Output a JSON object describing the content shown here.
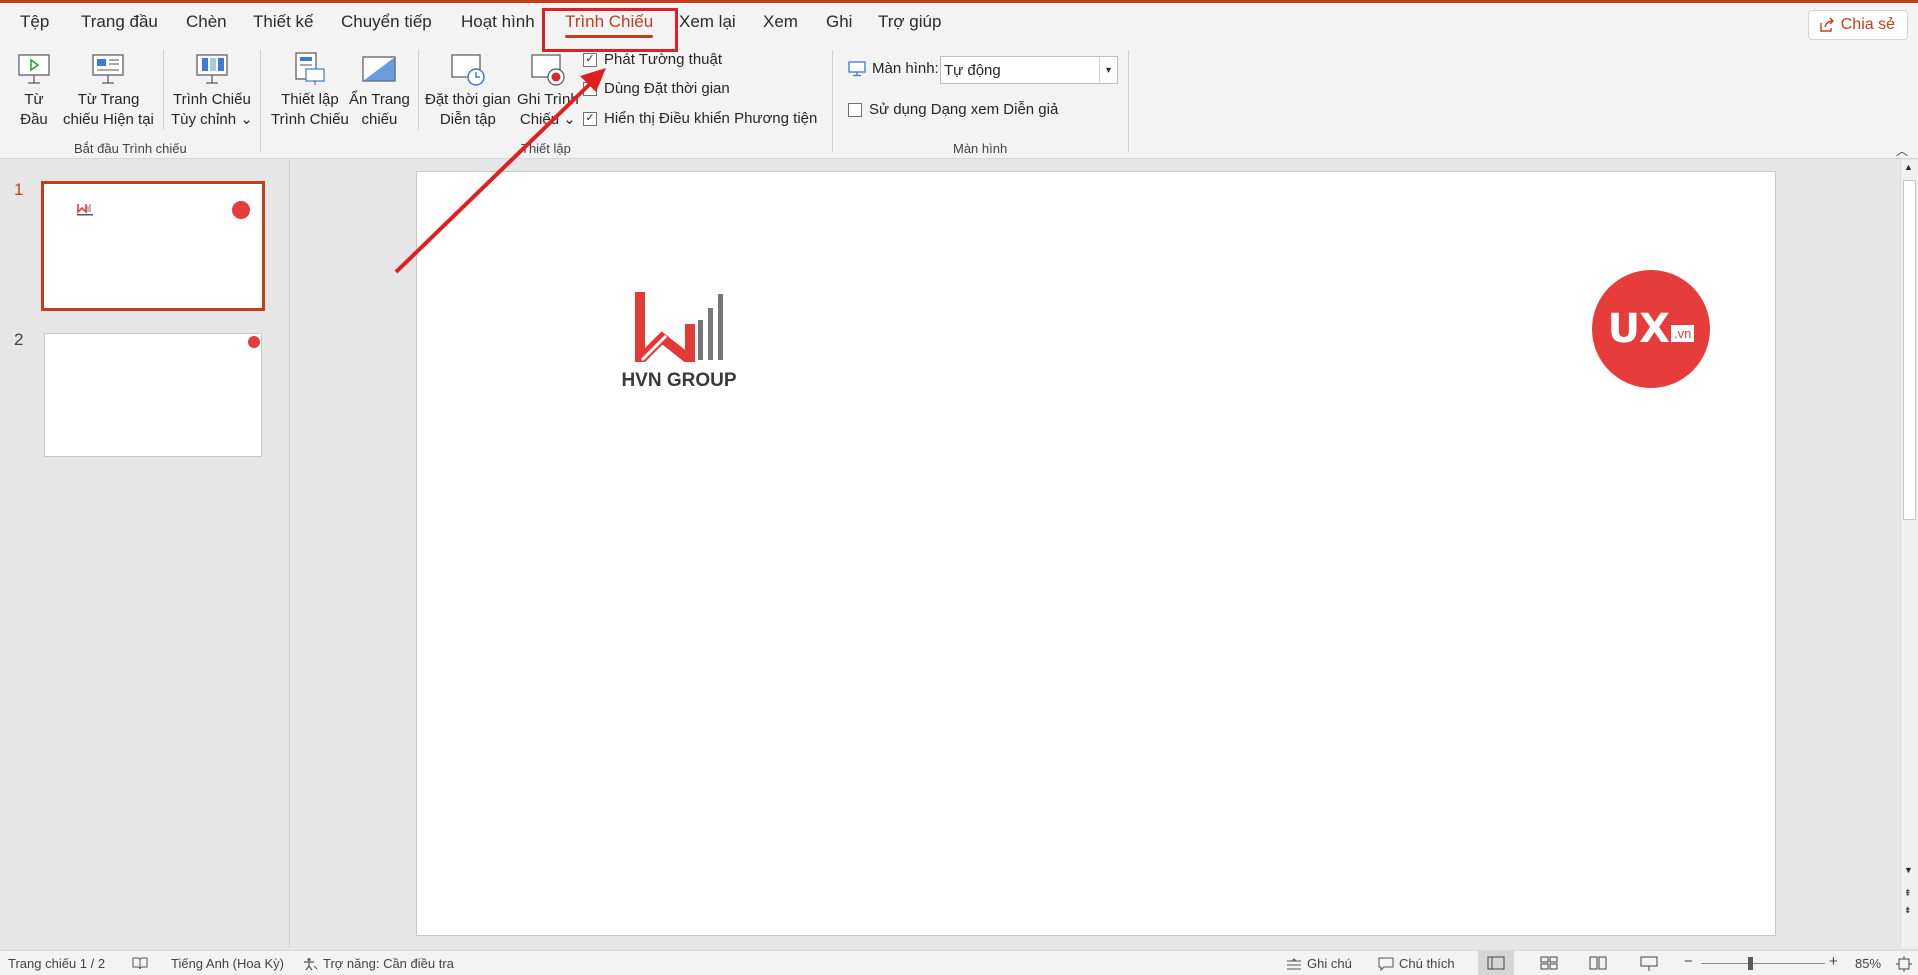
{
  "tabs": [
    {
      "label": "Tệp"
    },
    {
      "label": "Trang đầu"
    },
    {
      "label": "Chèn"
    },
    {
      "label": "Thiết kế"
    },
    {
      "label": "Chuyển tiếp"
    },
    {
      "label": "Hoạt hình"
    },
    {
      "label": "Trình Chiếu"
    },
    {
      "label": "Xem lại"
    },
    {
      "label": "Xem"
    },
    {
      "label": "Ghi"
    },
    {
      "label": "Trợ giúp"
    }
  ],
  "active_tab": "Trình Chiếu",
  "share_label": "Chia sẻ",
  "ribbon": {
    "start_group": {
      "label": "Bắt đầu Trình chiếu",
      "from_beginning": [
        "Từ",
        "Đầu"
      ],
      "from_current": [
        "Từ Trang",
        "chiếu Hiện tại"
      ],
      "custom": [
        "Trình Chiếu",
        "Tùy chỉnh ⌄"
      ]
    },
    "setup_group": {
      "label": "Thiết lập",
      "setup_show": [
        "Thiết lập",
        "Trình Chiếu"
      ],
      "hide_slide": [
        "Ẩn Trang",
        "chiếu"
      ],
      "rehearse": [
        "Đặt thời gian",
        "Diễn tập"
      ],
      "record": [
        "Ghi Trình",
        "Chiếu ⌄"
      ],
      "play_narrations": "Phát Tường thuật",
      "use_timings": "Dùng Đặt thời gian",
      "show_media_controls": "Hiển thị Điều khiển Phương tiện"
    },
    "monitor_group": {
      "label": "Màn hình",
      "monitor_label": "Màn hình:",
      "monitor_value": "Tự động",
      "presenter_view": "Sử dụng Dạng xem Diễn giả"
    }
  },
  "checkbox_states": {
    "play_narrations": true,
    "use_timings": false,
    "show_media_controls": true,
    "presenter_view": false
  },
  "slides": [
    {
      "number": "1"
    },
    {
      "number": "2"
    }
  ],
  "slide_content": {
    "left_logo_text": "HVN GROUP",
    "right_logo_text": "UX",
    "right_logo_suffix": ".vn"
  },
  "status": {
    "slide_info": "Trang chiếu 1 / 2",
    "language": "Tiếng Anh (Hoa Kỳ)",
    "accessibility": "Trợ năng: Cần điều tra",
    "notes": "Ghi chú",
    "comments": "Chú thích",
    "zoom": "85%"
  },
  "colors": {
    "accent": "#c43e1c",
    "annotation": "#e02020",
    "hvn_red": "#e33a36",
    "ux_red": "#e63c3c"
  }
}
